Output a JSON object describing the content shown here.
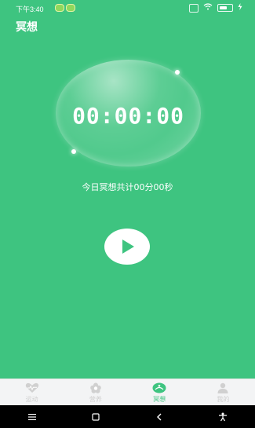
{
  "status": {
    "time": "下午3:40"
  },
  "header": {
    "title": "冥想"
  },
  "timer": {
    "value": "00:00:00",
    "daily_summary": "今日冥想共计00分00秒"
  },
  "colors": {
    "background": "#3ec480",
    "accent": "#3ec480",
    "tab_inactive": "#d0d0d0"
  },
  "tabs": [
    {
      "label": "运动",
      "icon": "heart-pulse-icon",
      "active": false
    },
    {
      "label": "营养",
      "icon": "flower-icon",
      "active": false
    },
    {
      "label": "冥想",
      "icon": "meditation-icon",
      "active": true
    },
    {
      "label": "我的",
      "icon": "person-icon",
      "active": false
    }
  ],
  "controls": {
    "play": "play-icon"
  }
}
